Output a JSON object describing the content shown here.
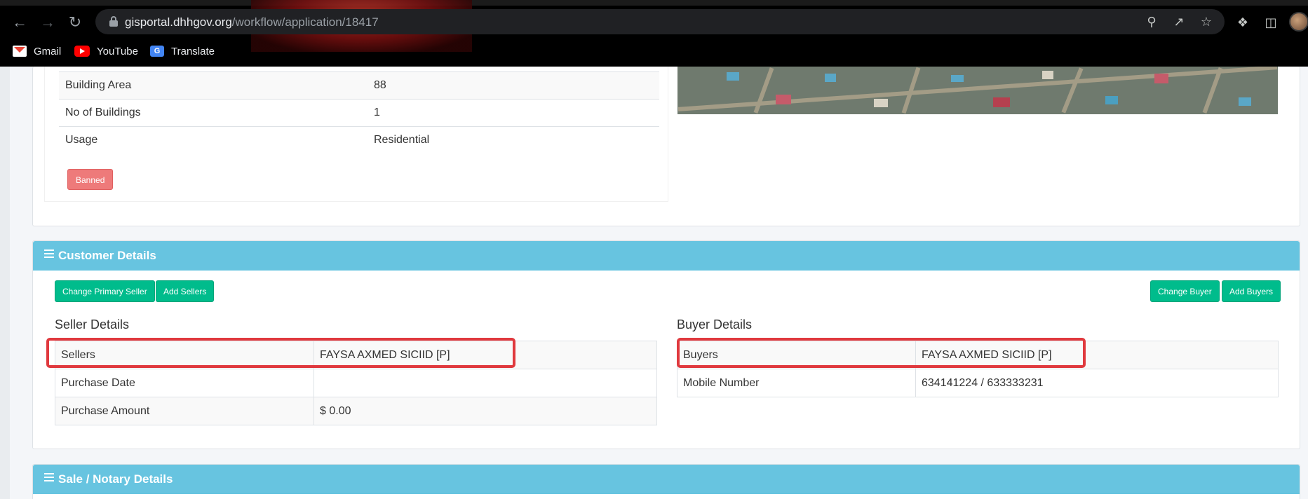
{
  "browser": {
    "url_host": "gisportal.dhhgov.org",
    "url_path": "/workflow/application/18417",
    "bookmarks": [
      {
        "label": "Gmail",
        "icon": "gmail-icon"
      },
      {
        "label": "YouTube",
        "icon": "youtube-icon"
      },
      {
        "label": "Translate",
        "icon": "translate-icon"
      }
    ]
  },
  "property": {
    "rows": [
      {
        "label": "Building Area",
        "value": "88"
      },
      {
        "label": "No of Buildings",
        "value": "1"
      },
      {
        "label": "Usage",
        "value": "Residential"
      }
    ],
    "banned_label": "Banned"
  },
  "customer": {
    "header": "Customer Details",
    "change_primary_seller_label": "Change Primary Seller",
    "add_sellers_label": "Add Sellers",
    "change_buyer_label": "Change Buyer",
    "add_buyers_label": "Add Buyers",
    "seller": {
      "title": "Seller Details",
      "rows": [
        {
          "label": "Sellers",
          "value": "FAYSA AXMED SICIID [P]"
        },
        {
          "label": "Purchase Date",
          "value": ""
        },
        {
          "label": "Purchase Amount",
          "value": "$ 0.00"
        }
      ]
    },
    "buyer": {
      "title": "Buyer Details",
      "rows": [
        {
          "label": "Buyers",
          "value": "FAYSA AXMED SICIID [P]"
        },
        {
          "label": "Mobile Number",
          "value": "634141224 / 633333231"
        }
      ]
    }
  },
  "sale": {
    "header": "Sale / Notary Details"
  },
  "colors": {
    "header_blue": "#67c4e0",
    "button_green": "#00bc8c",
    "banned_red": "#ee7a7a",
    "highlight_red": "#e0393e"
  }
}
